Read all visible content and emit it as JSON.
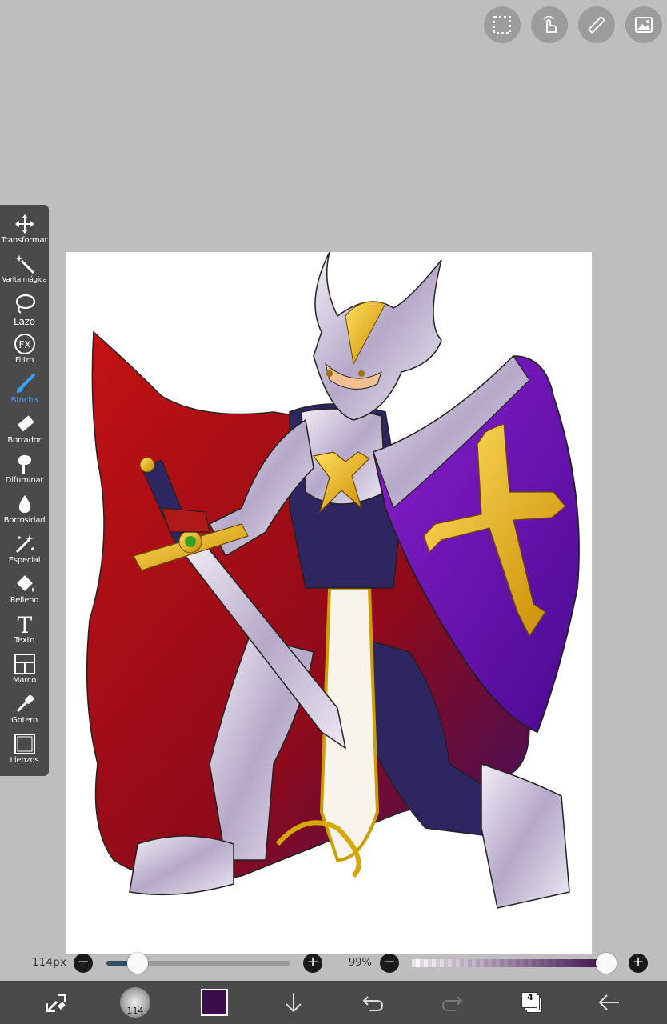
{
  "top_buttons": [
    {
      "name": "selection-icon"
    },
    {
      "name": "touch-gesture-icon"
    },
    {
      "name": "ruler-icon"
    },
    {
      "name": "image-icon"
    }
  ],
  "tools": [
    {
      "label": "Transformar",
      "icon": "move-arrows-icon"
    },
    {
      "label": "Varita mágica",
      "icon": "magic-wand-icon"
    },
    {
      "label": "Lazo",
      "icon": "lasso-icon"
    },
    {
      "label": "Filtro",
      "icon": "fx-icon"
    },
    {
      "label": "Brocha",
      "icon": "brush-icon"
    },
    {
      "label": "Borrador",
      "icon": "eraser-icon"
    },
    {
      "label": "Difuminar",
      "icon": "smudge-icon"
    },
    {
      "label": "Borrosidad",
      "icon": "blur-drop-icon"
    },
    {
      "label": "Especial",
      "icon": "sparkle-icon"
    },
    {
      "label": "Relleno",
      "icon": "fill-bucket-icon"
    },
    {
      "label": "Texto",
      "icon": "text-icon"
    },
    {
      "label": "Marco",
      "icon": "frame-icon"
    },
    {
      "label": "Gotero",
      "icon": "eyedropper-icon"
    },
    {
      "label": "Lienzos",
      "icon": "canvas-icon"
    }
  ],
  "active_tool": "Brocha",
  "brush": {
    "size_label": "114px",
    "size_fraction": 0.17
  },
  "opacity": {
    "label": "99%",
    "fraction": 0.99
  },
  "bottom_bar": {
    "brush_size_badge": "114",
    "layers_count": "4",
    "current_color": "#3a0e4a"
  },
  "colors": {
    "active_tool": "#3aa0ff",
    "toolbar_bg": "#4a4a4a",
    "background": "#bebebe"
  }
}
